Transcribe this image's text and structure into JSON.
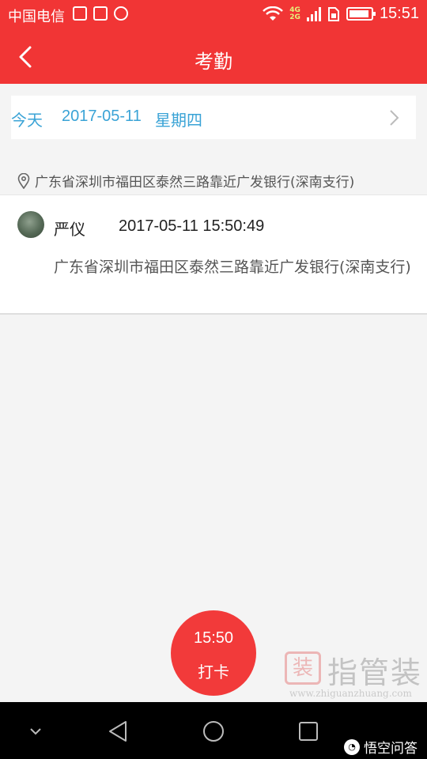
{
  "status_bar": {
    "carrier": "中国电信",
    "network_labels": [
      "4G",
      "2G"
    ],
    "time": "15:51"
  },
  "header": {
    "title": "考勤"
  },
  "date_bar": {
    "today_label": "今天",
    "date": "2017-05-11",
    "weekday": "星期四"
  },
  "current_location": "广东省深圳市福田区泰然三路靠近广发银行(深南支行)",
  "records": [
    {
      "name": "严仪",
      "timestamp": "2017-05-11 15:50:49",
      "address": "广东省深圳市福田区泰然三路靠近广发银行(深南支行)"
    }
  ],
  "punch_button": {
    "time": "15:50",
    "label": "打卡"
  },
  "watermark": {
    "logo_char": "装",
    "text": "指管装",
    "url": "www.zhiguanzhuang.com"
  },
  "nav_bar": {
    "credit": "悟空问答"
  },
  "colors": {
    "primary": "#f13535",
    "accent_blue": "#3aa3d6",
    "background": "#f4f4f4"
  }
}
